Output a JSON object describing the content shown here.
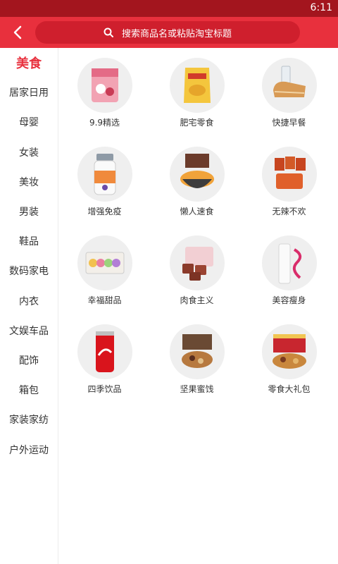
{
  "status": {
    "time": "6:11"
  },
  "header": {
    "search_placeholder": "搜索商品名或粘贴淘宝标题"
  },
  "sidebar": {
    "items": [
      {
        "label": "美食"
      },
      {
        "label": "居家日用"
      },
      {
        "label": "母婴"
      },
      {
        "label": "女装"
      },
      {
        "label": "美妆"
      },
      {
        "label": "男装"
      },
      {
        "label": "鞋品"
      },
      {
        "label": "数码家电"
      },
      {
        "label": "内衣"
      },
      {
        "label": "文娱车品"
      },
      {
        "label": "配饰"
      },
      {
        "label": "箱包"
      },
      {
        "label": "家装家纺"
      },
      {
        "label": "户外运动"
      }
    ]
  },
  "categories": [
    {
      "label": "9.9精选"
    },
    {
      "label": "肥宅零食"
    },
    {
      "label": "快捷早餐"
    },
    {
      "label": "增强免疫"
    },
    {
      "label": "懒人速食"
    },
    {
      "label": "无辣不欢"
    },
    {
      "label": "幸福甜品"
    },
    {
      "label": "肉食主义"
    },
    {
      "label": "美容瘦身"
    },
    {
      "label": "四季饮品"
    },
    {
      "label": "坚果蜜饯"
    },
    {
      "label": "零食大礼包"
    }
  ]
}
